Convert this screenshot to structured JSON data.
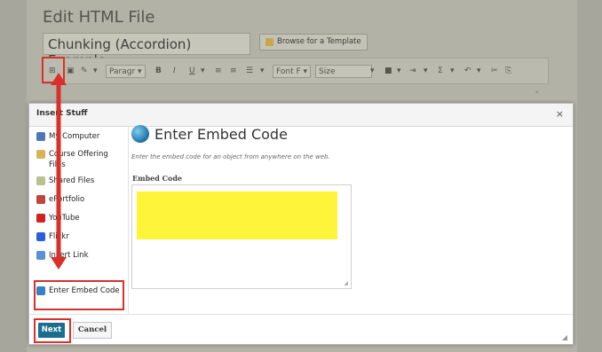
{
  "page": {
    "edit_title": "Edit HTML File",
    "file_name": "Chunking (Accordion) Example",
    "browse_template_label": "Browse for a Template"
  },
  "toolbar": {
    "paragraph_label": "Paragr",
    "font_label": "Font F",
    "size_label": "Size"
  },
  "dialog": {
    "title": "Insert Stuff",
    "close_glyph": "×",
    "sidebar": [
      {
        "label": "My Computer",
        "icon": "computer-icon",
        "color": "#4d78b8"
      },
      {
        "label": "Course Offering Files",
        "icon": "folder-icon",
        "color": "#d6b457"
      },
      {
        "label": "Shared Files",
        "icon": "shared-files-icon",
        "color": "#b7c28d"
      },
      {
        "label": "ePortfolio",
        "icon": "eportfolio-icon",
        "color": "#c0463b"
      },
      {
        "label": "YouTube",
        "icon": "youtube-icon",
        "color": "#d32020"
      },
      {
        "label": "Flickr",
        "icon": "flickr-icon",
        "color": "#2a5fd8"
      },
      {
        "label": "Insert Link",
        "icon": "link-icon",
        "color": "#5b8fd6"
      },
      {
        "label": "Enter Embed Code",
        "icon": "embed-code-icon",
        "color": "#3b7fc4"
      }
    ],
    "content": {
      "title": "Enter Embed Code",
      "description": "Enter the embed code for an object from anywhere on the web.",
      "embed_label": "Embed Code",
      "embed_value": ""
    },
    "footer": {
      "next_label": "Next",
      "cancel_label": "Cancel"
    }
  },
  "colors": {
    "highlight": "#d9302b",
    "primary_button": "#1a6e8e",
    "embed_fill": "#fef43a"
  }
}
